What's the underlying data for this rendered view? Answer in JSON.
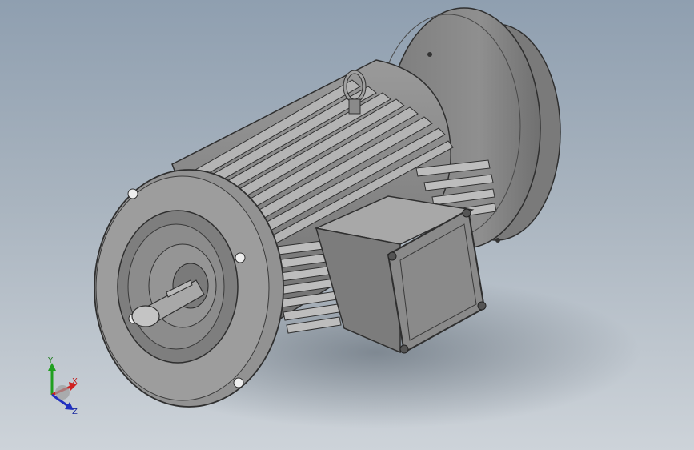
{
  "viewport": {
    "background_top": "#8f9fb0",
    "background_bottom": "#cdd3d9",
    "model_color": "#8c8c8c",
    "edge_color": "#2f2f2f"
  },
  "triad": {
    "x_label": "X",
    "y_label": "Y",
    "z_label": "Z",
    "x_color": "#d02020",
    "y_color": "#20a020",
    "z_color": "#2030c0"
  }
}
